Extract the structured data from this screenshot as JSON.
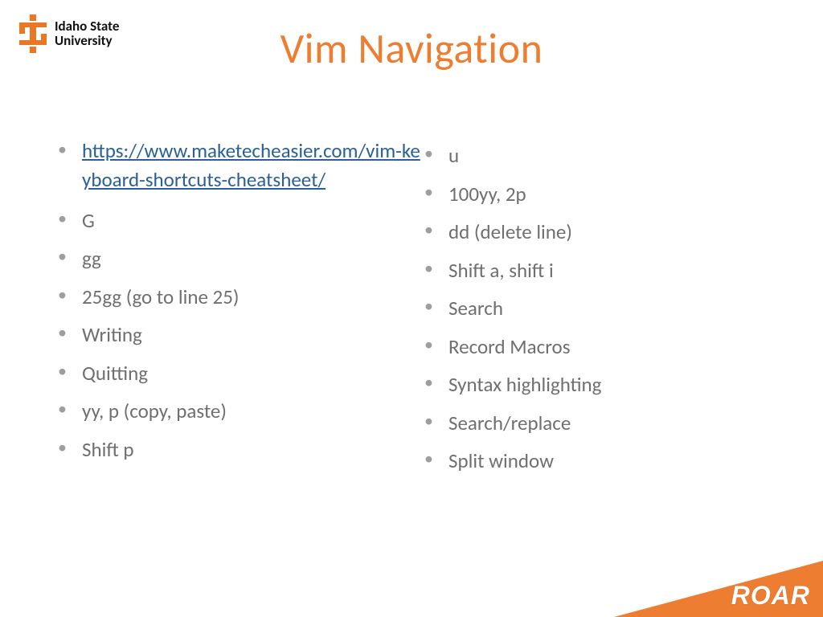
{
  "logo": {
    "institution_line1": "Idaho State",
    "institution_line2": "University"
  },
  "title": "Vim Navigation",
  "link": {
    "text": "https://www.maketecheasier.com/vim-keyboard-shortcuts-cheatsheet/",
    "href": "https://www.maketecheasier.com/vim-keyboard-shortcuts-cheatsheet/"
  },
  "left_items": [
    "G",
    "gg",
    "25gg (go to line 25)",
    "Writing",
    "Quitting",
    "yy, p (copy, paste)",
    "Shift p"
  ],
  "right_items": [
    "u",
    "100yy, 2p",
    "dd  (delete line)",
    "Shift a, shift i",
    "Search",
    "Record Macros",
    "Syntax highlighting",
    "Search/replace",
    "Split window"
  ],
  "roar": "ROAR",
  "colors": {
    "accent": "#ed7d31",
    "body_text": "#6f6f6f",
    "link": "#2a6099"
  }
}
